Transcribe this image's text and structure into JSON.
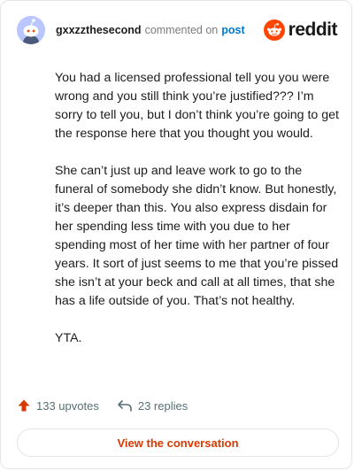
{
  "header": {
    "username": "gxxzzthesecond",
    "action_text": "commented on",
    "post_link": "post",
    "brand_name": "reddit"
  },
  "comment": {
    "paragraphs": [
      "You had a licensed professional tell you you were wrong and you still think you’re justified??? I’m sorry to tell you, but I don’t think you’re going to get the response here that you thought you would.",
      "She can’t just up and leave work to go to the funeral of somebody she didn’t know. But honestly, it’s deeper than this. You also express disdain for her spending less time with you due to her spending most of her time with her partner of four years. It sort of just seems to me that you’re pissed she isn’t at your beck and call at all times, that she has a life outside of you. That’s not healthy.",
      "YTA."
    ]
  },
  "stats": {
    "upvotes": "133 upvotes",
    "replies": "23 replies"
  },
  "cta": {
    "label": "View the conversation"
  },
  "colors": {
    "reddit_orange": "#ff4500",
    "upvote_orange": "#d93900",
    "link_blue": "#0079d3",
    "avatar_bg": "#b9c6ff"
  },
  "icons": {
    "avatar": "snoo-avatar-icon",
    "brand": "reddit-logo-icon",
    "upvote": "upvote-arrow-icon",
    "reply": "reply-arrow-icon"
  }
}
